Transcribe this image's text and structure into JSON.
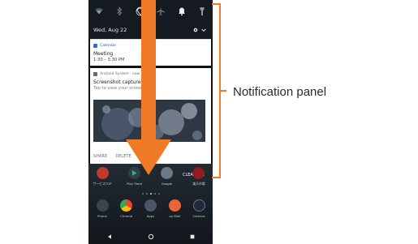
{
  "status_bar": {
    "icons": [
      "wifi-icon",
      "bluetooth-icon",
      "rotate-icon",
      "airplane-icon",
      "bell-icon",
      "flashlight-icon"
    ],
    "date": "Wed, Aug 22"
  },
  "notifications": [
    {
      "app": "Calendar",
      "title": "Meeting",
      "body": "1:30 – 3:30 PM"
    },
    {
      "app": "Android System · now",
      "title": "Screenshot captured.",
      "body": "Tap to view your screens",
      "actions": [
        "SHARE",
        "DELETE"
      ]
    }
  ],
  "home": {
    "clear_all": "CLEAR ALL",
    "top_row": [
      "サービスTOP",
      "Play Store",
      "Google",
      "楽天市場"
    ],
    "dock": [
      "Phone",
      "Chrome",
      "Apps",
      "au Mail",
      "Camera"
    ]
  },
  "callout": {
    "label": "Notification panel"
  },
  "colors": {
    "arrow": "#f07b26",
    "bracket": "#f07b26",
    "panel_dark": "#151a20",
    "accent_blue": "#2b4fa8"
  }
}
